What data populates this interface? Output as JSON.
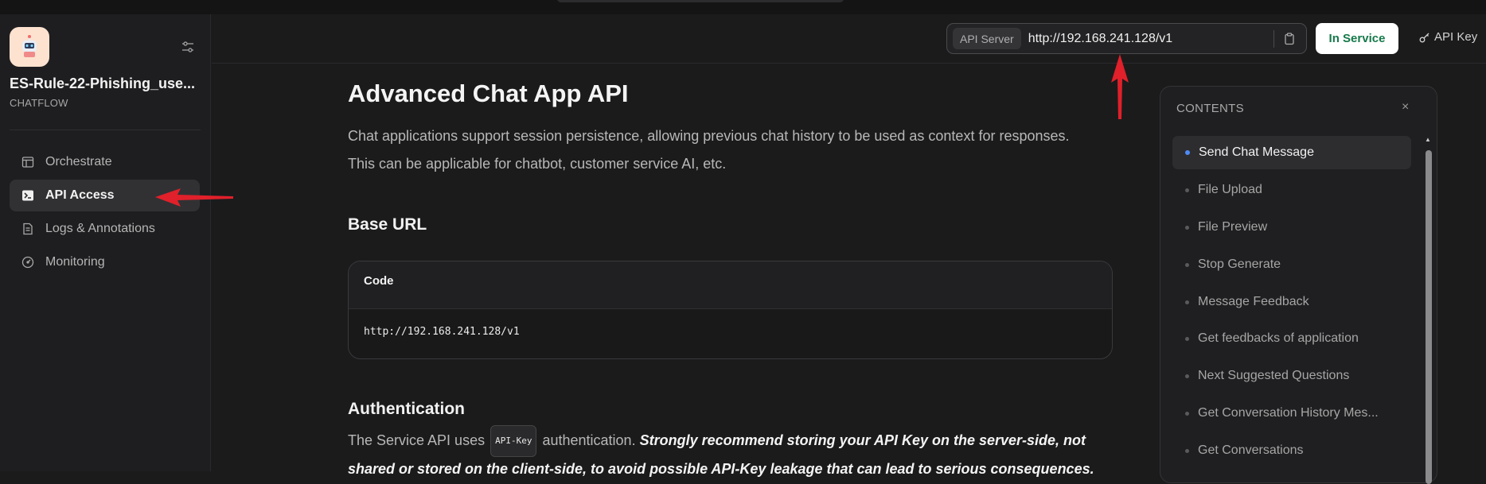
{
  "sidebar": {
    "app_name": "ES-Rule-22-Phishing_use...",
    "app_type": "CHATFLOW",
    "nav": [
      {
        "label": "Orchestrate",
        "icon": "layout-icon"
      },
      {
        "label": "API Access",
        "icon": "terminal-icon",
        "active": true
      },
      {
        "label": "Logs & Annotations",
        "icon": "file-list-icon"
      },
      {
        "label": "Monitoring",
        "icon": "gauge-icon"
      }
    ]
  },
  "header": {
    "api_server_label": "API Server",
    "api_server_url": "http://192.168.241.128/v1",
    "status_button": "In Service",
    "api_key_button": "API Key"
  },
  "main": {
    "title": "Advanced Chat App API",
    "intro_line1": "Chat applications support session persistence, allowing previous chat history to be used as context for responses.",
    "intro_line2": "This can be applicable for chatbot, customer service AI, etc.",
    "base_url_heading": "Base URL",
    "code_label": "Code",
    "code_value": "http://192.168.241.128/v1",
    "auth_heading": "Authentication",
    "auth_text_prefix": "The Service API uses",
    "auth_chip": "API-Key",
    "auth_text_mid": "authentication.",
    "auth_strong": "Strongly recommend storing your API Key on the server-side, not",
    "auth_strong_line2": "shared or stored on the client-side, to avoid possible API-Key leakage that can lead to serious consequences."
  },
  "toc": {
    "title": "CONTENTS",
    "close": "×",
    "items": [
      "Send Chat Message",
      "File Upload",
      "File Preview",
      "Stop Generate",
      "Message Feedback",
      "Get feedbacks of application",
      "Next Suggested Questions",
      "Get Conversation History Mes...",
      "Get Conversations"
    ],
    "active_index": 0
  },
  "colors": {
    "background": "#1b1b1c",
    "sidebar": "#1e1e20",
    "active_dot": "#4f8bf5",
    "in_service_text": "#16794a",
    "annotation_arrow": "#e0202a"
  }
}
